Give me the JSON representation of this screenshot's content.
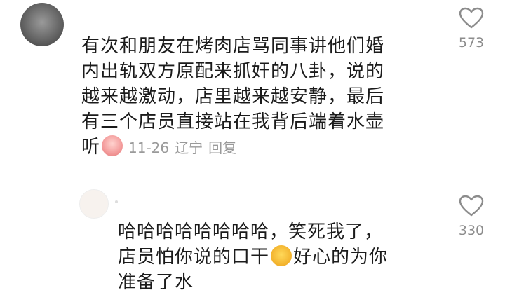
{
  "comments": [
    {
      "lines": [
        "有次和朋友在烤肉店骂同事讲他们婚",
        "内出轨双方原配来抓奸的八卦，说的",
        "越来越激动，店里越来越安静，最后",
        "有三个店员直接站在我背后端着水壶",
        "听"
      ],
      "emoji": "loudly-crying-emoji",
      "date": "11-26",
      "location": "辽宁",
      "reply_label": "回复",
      "like_count": "573"
    },
    {
      "lines": [
        "哈哈哈哈哈哈哈哈，笑死我了，",
        "店员怕你说的口干",
        "好心的为你",
        "准备了水"
      ],
      "emoji": "thirsty-emoji",
      "like_count": "330"
    }
  ],
  "icons": {
    "like": "heart-outline-icon"
  },
  "colors": {
    "text": "#1b1b1b",
    "meta": "#9a9a9a",
    "icon": "#8c8c8c"
  }
}
